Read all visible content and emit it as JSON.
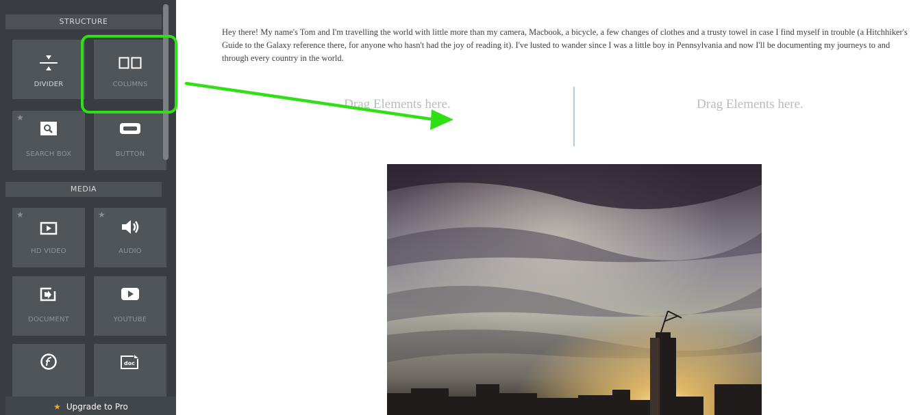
{
  "sidebar": {
    "structure_header": "STRUCTURE",
    "media_header": "MEDIA",
    "structure_tiles": [
      {
        "label": "DIVIDER",
        "icon": "divider-icon",
        "pro": false
      },
      {
        "label": "COLUMNS",
        "icon": "columns-icon",
        "pro": false
      },
      {
        "label": "SEARCH BOX",
        "icon": "search-box-icon",
        "pro": true
      },
      {
        "label": "BUTTON",
        "icon": "button-icon",
        "pro": false
      }
    ],
    "media_tiles": [
      {
        "label": "HD VIDEO",
        "icon": "hd-video-icon",
        "pro": true
      },
      {
        "label": "AUDIO",
        "icon": "audio-icon",
        "pro": true
      },
      {
        "label": "DOCUMENT",
        "icon": "document-icon",
        "pro": false
      },
      {
        "label": "YOUTUBE",
        "icon": "youtube-icon",
        "pro": false
      },
      {
        "label": "",
        "icon": "flash-icon",
        "pro": false
      },
      {
        "label": "",
        "icon": "doc-file-icon",
        "pro": false
      }
    ],
    "upgrade_label": "Upgrade to Pro"
  },
  "content": {
    "intro_text": "Hey there! My name's Tom and I'm travelling the world with little more than my camera, Macbook, a bicycle, a few changes of clothes and a trusty towel in case I find myself in trouble (a Hitchhiker's Guide to the Galaxy reference there, for anyone who hasn't had the joy of reading it). I've lusted to wander since I was a little boy in Pennsylvania and now I'll be documenting my journeys to and through every country in the world.",
    "drop_left": "Drag Elements here.",
    "drop_right": "Drag Elements here."
  },
  "colors": {
    "sidebar_bg": "#393d41",
    "tile_bg": "#50555a",
    "highlight": "#2ee014",
    "arrow": "#2ee014",
    "column_divider": "#a9cfe8",
    "upgrade_star": "#f0a830"
  }
}
